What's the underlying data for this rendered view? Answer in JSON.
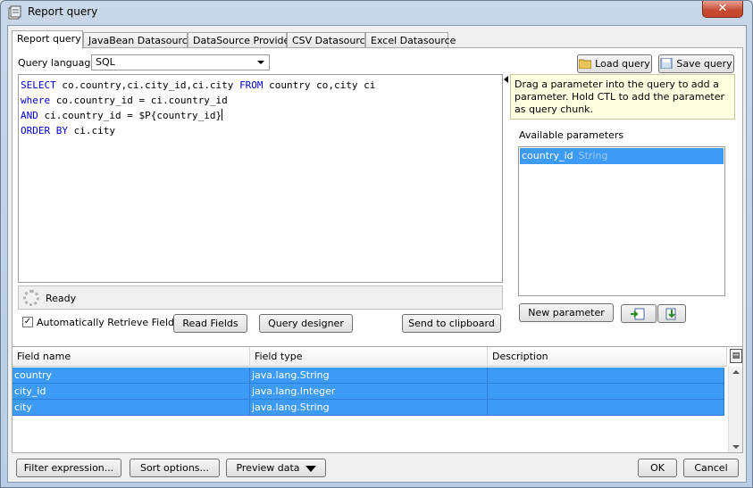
{
  "window": {
    "title": "Report query",
    "close_label": "✕"
  },
  "tabs": [
    {
      "label": "Report query"
    },
    {
      "label": "JavaBean Datasource"
    },
    {
      "label": "DataSource Provider"
    },
    {
      "label": "CSV Datasource"
    },
    {
      "label": "Excel Datasource"
    }
  ],
  "query_language": {
    "label": "Query language",
    "value": "SQL"
  },
  "buttons": {
    "load_query": "Load query",
    "save_query": "Save query",
    "read_fields": "Read Fields",
    "query_designer": "Query designer",
    "send_to_clipboard": "Send to clipboard",
    "new_parameter": "New parameter",
    "filter_expression": "Filter expression...",
    "sort_options": "Sort options...",
    "preview_data": "Preview data",
    "ok": "OK",
    "cancel": "Cancel"
  },
  "query": {
    "line1_kw1": "SELECT",
    "line1_a": " co.country,ci.city_id,ci.city ",
    "line1_kw2": "FROM",
    "line1_b": " country co,city ci",
    "line2_kw": "where",
    "line2_a": " co.country_id = ci.country_id",
    "line3_kw": "AND",
    "line3_a": " ci.country_id = $P{country_id}",
    "line4_kw": "ORDER BY",
    "line4_a": " ci.city"
  },
  "status": {
    "text": "Ready"
  },
  "auto_retrieve": {
    "label": "Automatically Retrieve Fields",
    "checked": true,
    "mark": "✓"
  },
  "hint": "Drag a parameter into the query to add a parameter. Hold CTL to add the parameter as query chunk.",
  "parameters": {
    "label": "Available parameters",
    "items": [
      {
        "name": "country_id",
        "type": "String"
      }
    ]
  },
  "fields": {
    "columns": [
      "Field name",
      "Field type",
      "Description"
    ],
    "rows": [
      {
        "name": "country",
        "type": "java.lang.String",
        "description": ""
      },
      {
        "name": "city_id",
        "type": "java.lang.Integer",
        "description": ""
      },
      {
        "name": "city",
        "type": "java.lang.String",
        "description": ""
      }
    ]
  },
  "colors": {
    "selection": "#3d9af5",
    "keyword": "#0000cc",
    "hint_bg": "#ffffe1"
  }
}
